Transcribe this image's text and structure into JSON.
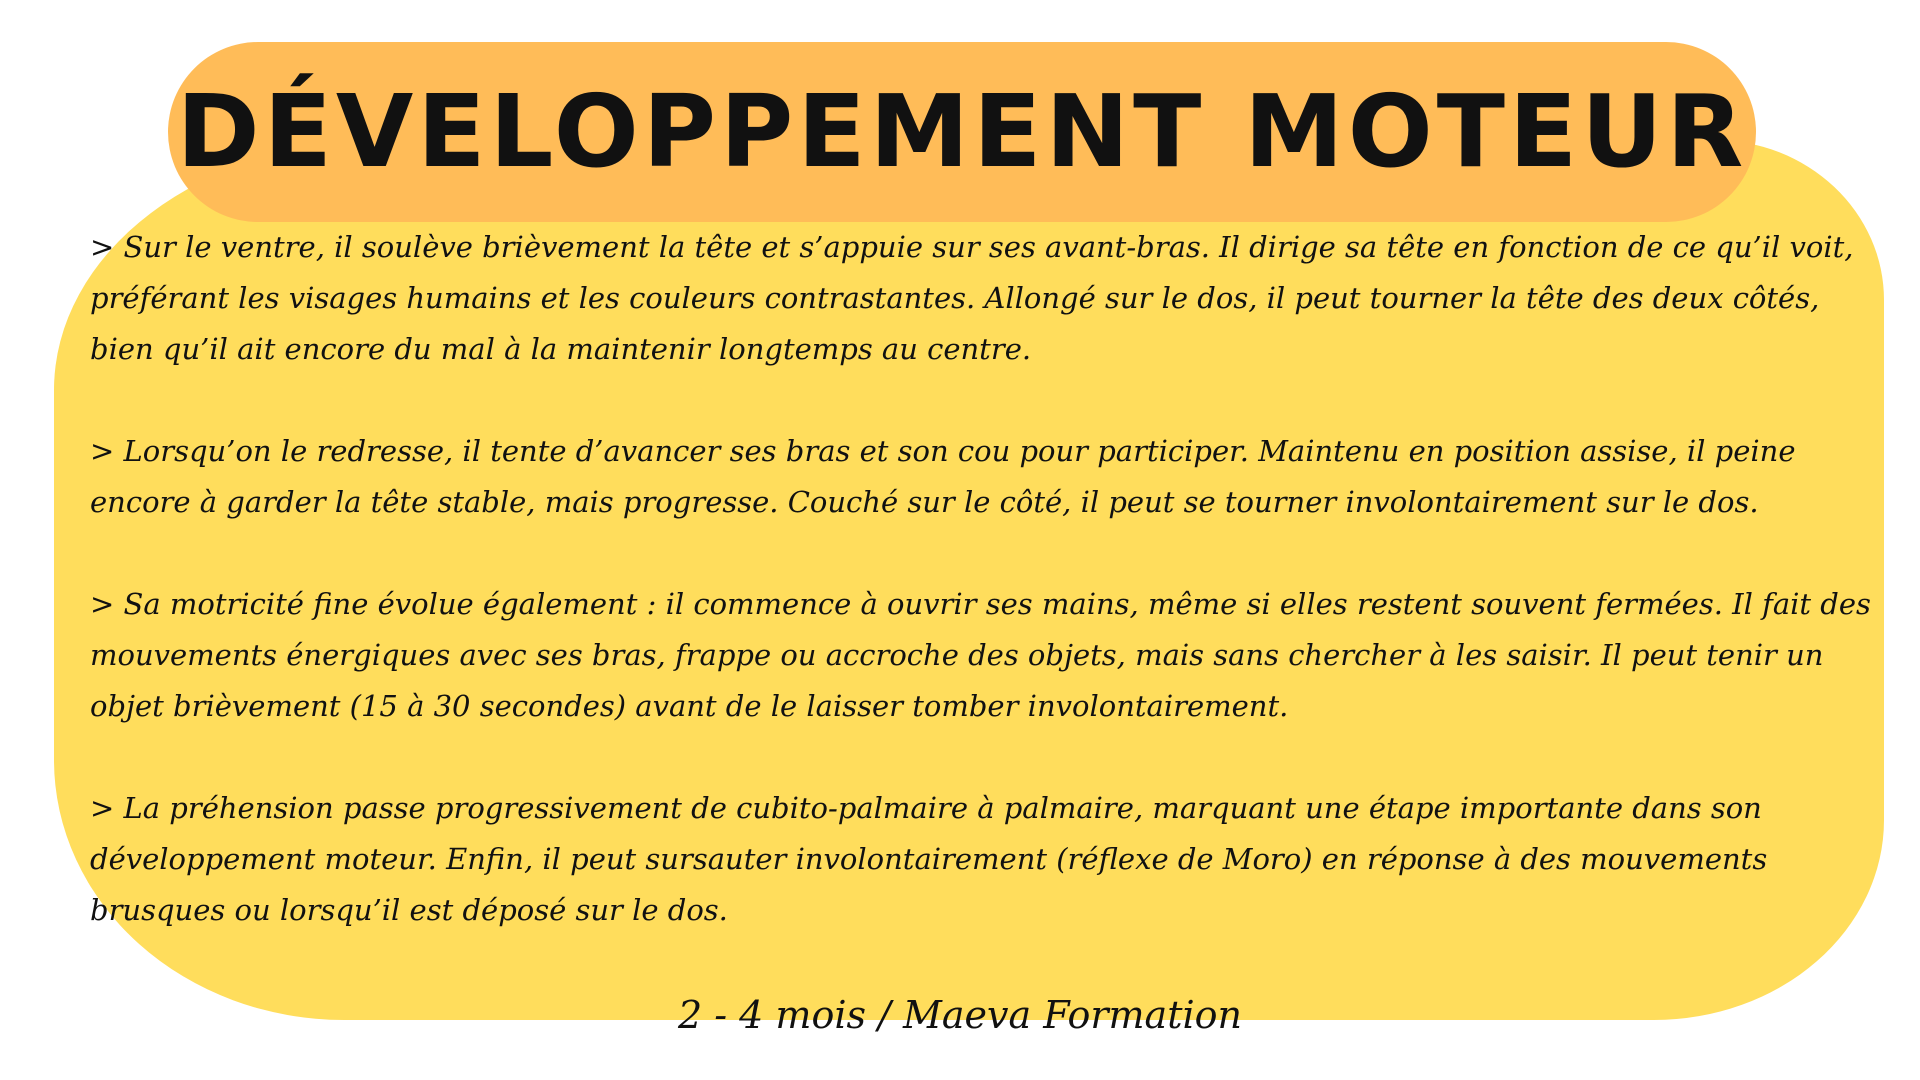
{
  "title": "DÉVELOPPEMENT MOTEUR",
  "paragraphs": [
    "> Sur le ventre, il soulève brièvement la tête et s’appuie sur ses avant-bras. Il dirige sa tête en fonction de ce qu’il voit, préférant les visages humains et les couleurs contrastantes. Allongé sur le dos, il peut tourner la tête des deux côtés, bien qu’il ait encore du mal à la maintenir longtemps au centre.",
    "> Lorsqu’on le redresse, il tente d’avancer ses bras et son cou pour participer. Maintenu en position assise, il peine encore à garder la tête stable, mais progresse. Couché sur le côté, il peut se tourner involontairement sur le dos.",
    "> Sa motricité fine évolue également : il commence à ouvrir ses mains, même si elles restent souvent fermées. Il fait des mouvements énergiques avec ses bras, frappe ou accroche des objets, mais sans chercher à les saisir. Il peut tenir un objet brièvement (15 à 30 secondes) avant de le laisser tomber involontairement.",
    "> La préhension passe progressivement de cubito-palmaire à palmaire, marquant une étape importante dans son développement moteur. Enfin, il peut sursauter involontairement (réflexe de Moro) en réponse à des mouvements brusques ou lorsqu’il est déposé sur le dos."
  ],
  "footer": "2 - 4 mois / Maeva Formation",
  "colors": {
    "card_background": "#FFDD5C",
    "title_pill": "#FFBC58",
    "text": "#111111"
  }
}
